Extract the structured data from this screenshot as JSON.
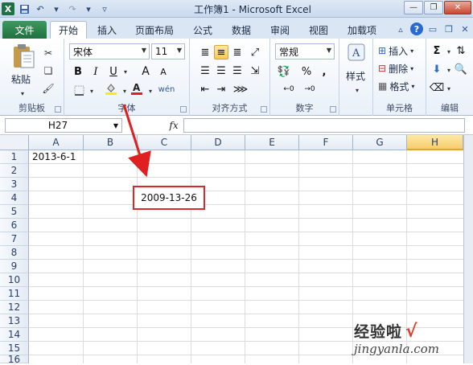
{
  "window": {
    "title": "工作簿1 - Microsoft Excel",
    "logo_letter": "X"
  },
  "ribbon_tabs": [
    {
      "label": "文件"
    },
    {
      "label": "开始"
    },
    {
      "label": "插入"
    },
    {
      "label": "页面布局"
    },
    {
      "label": "公式"
    },
    {
      "label": "数据"
    },
    {
      "label": "审阅"
    },
    {
      "label": "视图"
    },
    {
      "label": "加载项"
    }
  ],
  "ribbon": {
    "clipboard": {
      "paste_label": "粘贴",
      "group_label": "剪贴板"
    },
    "font": {
      "font_name": "宋体",
      "font_size": "11",
      "group_label": "字体",
      "bold": "B",
      "italic": "I",
      "underline": "U",
      "grow": "A",
      "shrink": "A",
      "wen": "wén"
    },
    "alignment": {
      "group_label": "对齐方式"
    },
    "number": {
      "format": "常规",
      "percent": "%",
      "comma": ",",
      "group_label": "数字"
    },
    "styles": {
      "label": "样式"
    },
    "cells": {
      "insert": "插入",
      "delete": "删除",
      "format": "格式",
      "group_label": "单元格"
    },
    "editing": {
      "sigma": "Σ",
      "group_label": "编辑"
    }
  },
  "formula_bar": {
    "name_box": "H27",
    "fx": "fx",
    "formula": ""
  },
  "sheet": {
    "columns": [
      "A",
      "B",
      "C",
      "D",
      "E",
      "F",
      "G",
      "H"
    ],
    "selected_column": "H",
    "rows": [
      "1",
      "2",
      "3",
      "4",
      "5",
      "6",
      "7",
      "8",
      "9",
      "10",
      "11",
      "12",
      "13",
      "14",
      "15",
      "16"
    ],
    "cell_a1": "2013-6-1",
    "callout_value": "2009-13-26"
  },
  "watermark": {
    "top": "经验啦",
    "check": "√",
    "bottom": "jingyanla.com"
  },
  "colors": {
    "file_tab": "#217346",
    "callout_border": "#d82a2a",
    "arrow": "#e02020",
    "selected_header": "#f8cd6a"
  }
}
